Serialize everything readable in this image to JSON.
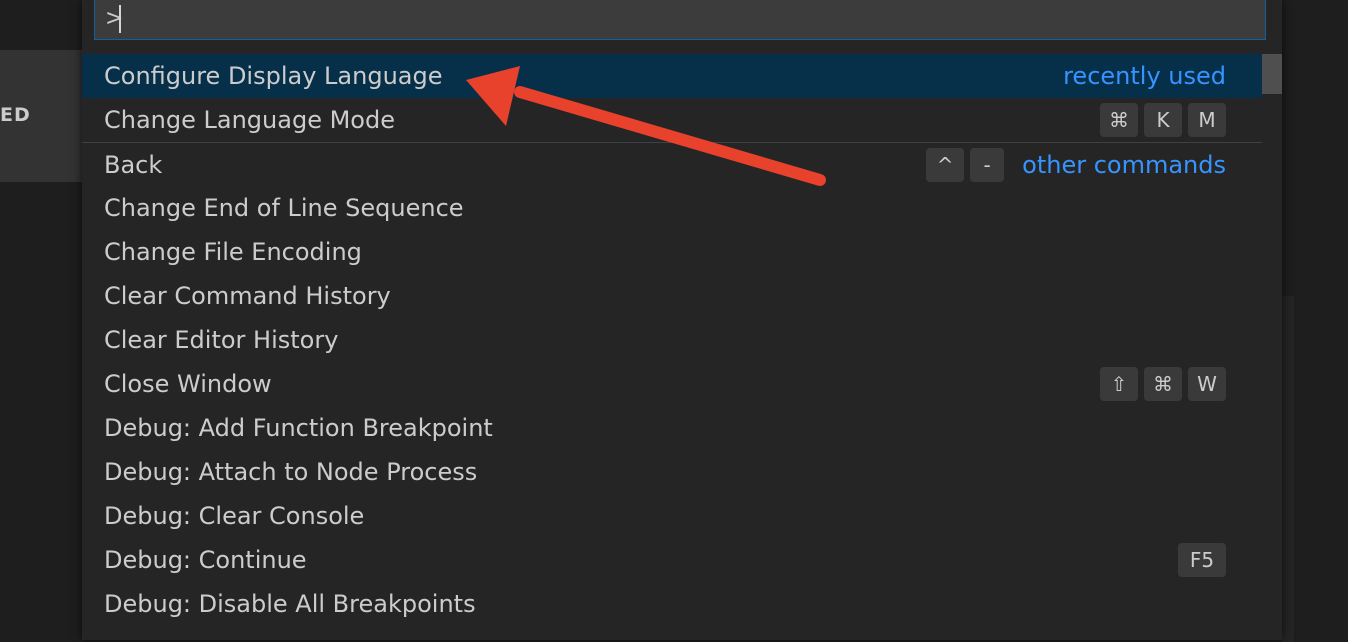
{
  "background": {
    "side_label": "ED"
  },
  "palette": {
    "input": {
      "value": ">"
    },
    "items": [
      {
        "label": "Configure Display Language",
        "meta": "recently used",
        "keys": [],
        "selected": true
      },
      {
        "label": "Change Language Mode",
        "meta": "",
        "keys": [
          "⌘",
          "K",
          "M"
        ]
      },
      {
        "label": "Back",
        "meta": "other commands",
        "keys": [
          "^",
          "-"
        ]
      },
      {
        "label": "Change End of Line Sequence",
        "meta": "",
        "keys": []
      },
      {
        "label": "Change File Encoding",
        "meta": "",
        "keys": []
      },
      {
        "label": "Clear Command History",
        "meta": "",
        "keys": []
      },
      {
        "label": "Clear Editor History",
        "meta": "",
        "keys": []
      },
      {
        "label": "Close Window",
        "meta": "",
        "keys": [
          "⇧",
          "⌘",
          "W"
        ]
      },
      {
        "label": "Debug: Add Function Breakpoint",
        "meta": "",
        "keys": []
      },
      {
        "label": "Debug: Attach to Node Process",
        "meta": "",
        "keys": []
      },
      {
        "label": "Debug: Clear Console",
        "meta": "",
        "keys": []
      },
      {
        "label": "Debug: Continue",
        "meta": "",
        "keys": [
          "F5"
        ]
      },
      {
        "label": "Debug: Disable All Breakpoints",
        "meta": "",
        "keys": []
      }
    ]
  },
  "colors": {
    "selection": "#062f4a",
    "accent": "#3794ff",
    "annotation": "#e8412c"
  },
  "icons": {
    "annotation_arrow": "red-arrow-icon"
  }
}
